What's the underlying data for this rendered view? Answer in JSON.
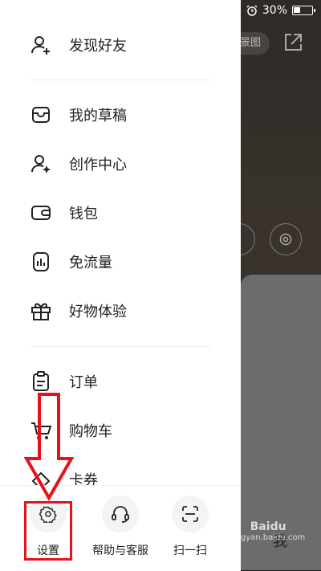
{
  "status_bar": {
    "battery": "30%"
  },
  "background": {
    "pill_text": "景图",
    "tab_fragment": "我"
  },
  "drawer": {
    "items": [
      {
        "label": "发现好友",
        "icon": "add-friend-icon"
      },
      {
        "label": "我的草稿",
        "icon": "drafts-icon"
      },
      {
        "label": "创作中心",
        "icon": "creator-center-icon"
      },
      {
        "label": "钱包",
        "icon": "wallet-icon"
      },
      {
        "label": "免流量",
        "icon": "data-free-icon"
      },
      {
        "label": "好物体验",
        "icon": "gift-icon"
      },
      {
        "label": "订单",
        "icon": "order-icon"
      },
      {
        "label": "购物车",
        "icon": "cart-icon"
      },
      {
        "label": "卡券",
        "icon": "coupon-icon"
      }
    ]
  },
  "bottom_bar": {
    "settings": "设置",
    "help": "帮助与客服",
    "scan": "扫一扫"
  },
  "annotation": {
    "highlight_color": "#e8101a"
  },
  "watermark": {
    "line1": "Baidu",
    "line2": "jingyan.baidu.com"
  }
}
